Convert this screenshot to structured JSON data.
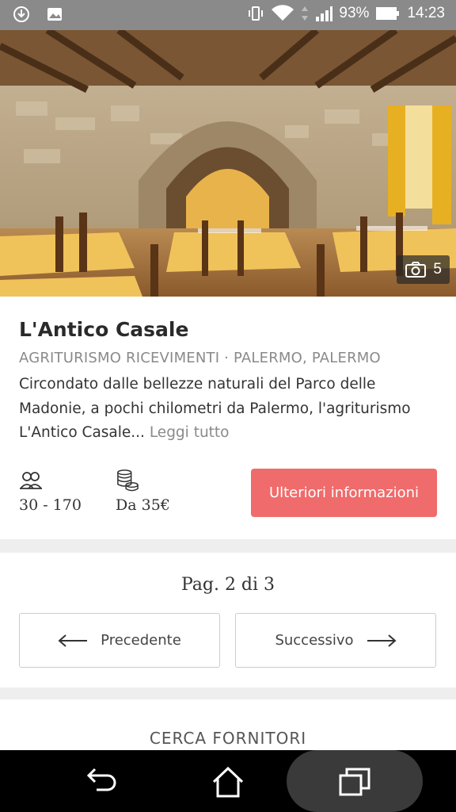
{
  "status_bar": {
    "battery": "93%",
    "time": "14:23",
    "icons": [
      "sync-icon",
      "image-icon",
      "vibrate-icon",
      "wifi-icon",
      "data-arrows-icon",
      "signal-icon",
      "battery-icon"
    ]
  },
  "hero": {
    "photo_count": "5",
    "icon": "camera-icon"
  },
  "listing": {
    "title": "L'Antico Casale",
    "subtitle": "AGRITURISMO RICEVIMENTI · PALERMO, PALERMO",
    "description": "Circondato dalle bellezze naturali del Parco delle Madonie, a pochi chilometri da Palermo, l'agriturismo L'Antico Casale...",
    "read_more": "Leggi tutto",
    "guests": "30 - 170",
    "price": "Da 35€",
    "cta_label": "Ulteriori informazioni"
  },
  "pagination": {
    "page_info": "Pag. 2 di 3",
    "prev_label": "Precedente",
    "next_label": "Successivo"
  },
  "section": {
    "title": "CERCA FORNITORI"
  },
  "colors": {
    "accent": "#f06b6b",
    "status_bar": "#8a8a8a",
    "separator": "#eeeeee"
  }
}
